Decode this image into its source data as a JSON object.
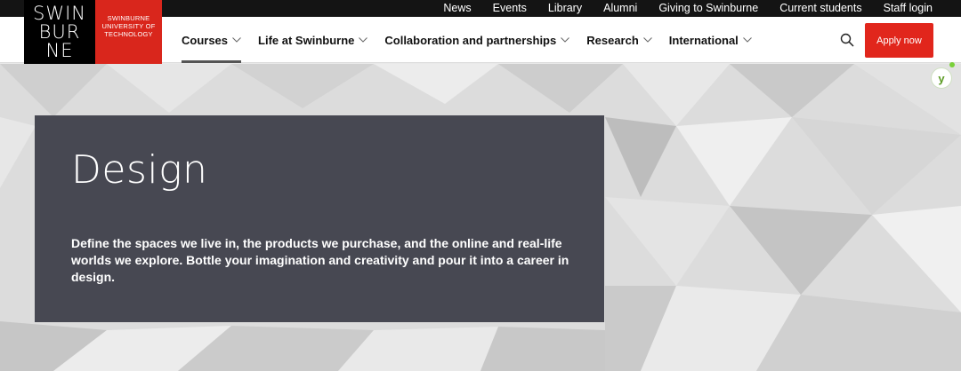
{
  "top_links": [
    "News",
    "Events",
    "Library",
    "Alumni",
    "Giving to Swinburne",
    "Current students",
    "Staff login"
  ],
  "logo": {
    "mark_lines": [
      "SWIN",
      "BUR",
      "NE"
    ],
    "wordmark_lines": [
      "SWINBURNE",
      "UNIVERSITY OF",
      "TECHNOLOGY"
    ]
  },
  "nav": {
    "items": [
      "Courses",
      "Life at Swinburne",
      "Collaboration and partnerships",
      "Research",
      "International"
    ],
    "active_index": 0,
    "apply_label": "Apply now"
  },
  "hero": {
    "title": "Design",
    "text": "Define the spaces we live in, the products we purchase, and the online and real-life worlds we explore. Bottle your imagination and creativity and pour it into a career in design."
  },
  "yoast": {
    "label": "y"
  },
  "colors": {
    "brand_red": "#e1261c",
    "card": "#474852",
    "topbar": "#141414"
  }
}
